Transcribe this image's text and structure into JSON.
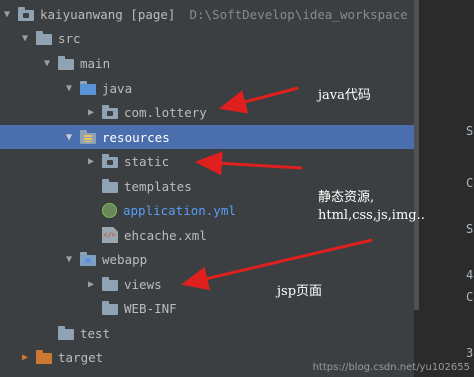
{
  "tree": {
    "project_name": "kaiyuanwang [page]",
    "project_path": "D:\\SoftDevelop\\idea_workspace",
    "items": [
      {
        "label": "src"
      },
      {
        "label": "main"
      },
      {
        "label": "java"
      },
      {
        "label": "com.lottery"
      },
      {
        "label": "resources"
      },
      {
        "label": "static"
      },
      {
        "label": "templates"
      },
      {
        "label": "application.yml"
      },
      {
        "label": "ehcache.xml"
      },
      {
        "label": "webapp"
      },
      {
        "label": "views"
      },
      {
        "label": "WEB-INF"
      },
      {
        "label": "test"
      },
      {
        "label": "target"
      }
    ]
  },
  "annotations": {
    "java": "java代码",
    "static_line1": "静态资源,",
    "static_line2": "html,css,js,img..",
    "jsp": "jsp页面"
  },
  "watermark": "https://blog.csdn.net/yu102655",
  "gutter_glyphs": [
    "S",
    "C",
    "S",
    "4",
    "C",
    "3"
  ],
  "colors": {
    "selection": "#4b6eaf",
    "arrow": "#e0201e",
    "link_blue": "#589df6"
  }
}
